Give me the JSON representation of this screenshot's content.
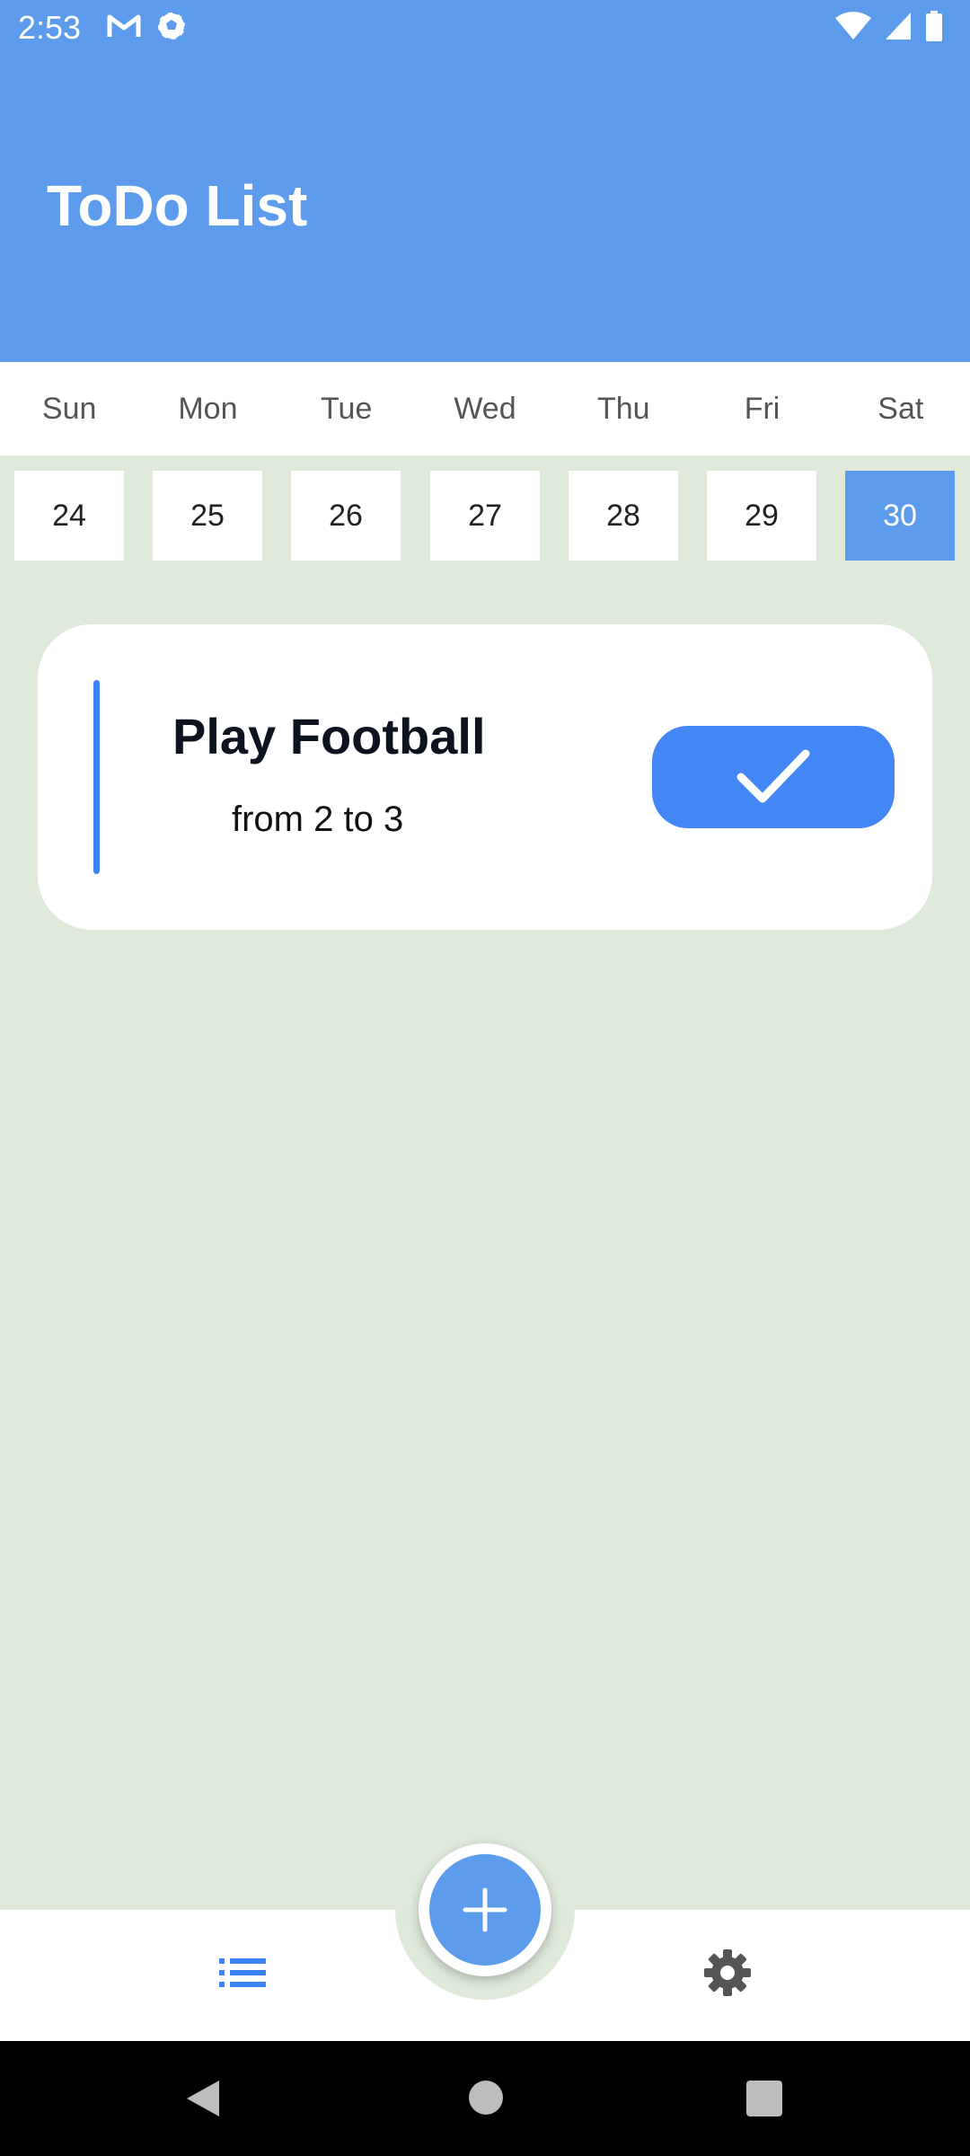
{
  "status_bar": {
    "time": "2:53",
    "left_icons": [
      "gmail-icon",
      "soccer-ball-icon"
    ],
    "right_icons": [
      "wifi-icon",
      "cellular-signal-icon",
      "battery-icon"
    ]
  },
  "app_bar": {
    "title": "ToDo List"
  },
  "calendar": {
    "weekdays": [
      "Sun",
      "Mon",
      "Tue",
      "Wed",
      "Thu",
      "Fri",
      "Sat"
    ],
    "dates": [
      "24",
      "25",
      "26",
      "27",
      "28",
      "29",
      "30"
    ],
    "selected_date": "30"
  },
  "tasks": [
    {
      "title": "Play Football",
      "time": "from 2 to 3"
    }
  ],
  "bottom_nav": {
    "items": [
      "list-icon",
      "settings-icon"
    ],
    "fab_icon": "plus-icon"
  },
  "system_nav": [
    "back-icon",
    "home-icon",
    "recents-icon"
  ],
  "colors": {
    "primary": "#5d9cec",
    "background": "#dfeadb",
    "accent_bar": "#3b82f6",
    "list_icon_active": "#3b82f6",
    "settings_icon": "#555555"
  }
}
